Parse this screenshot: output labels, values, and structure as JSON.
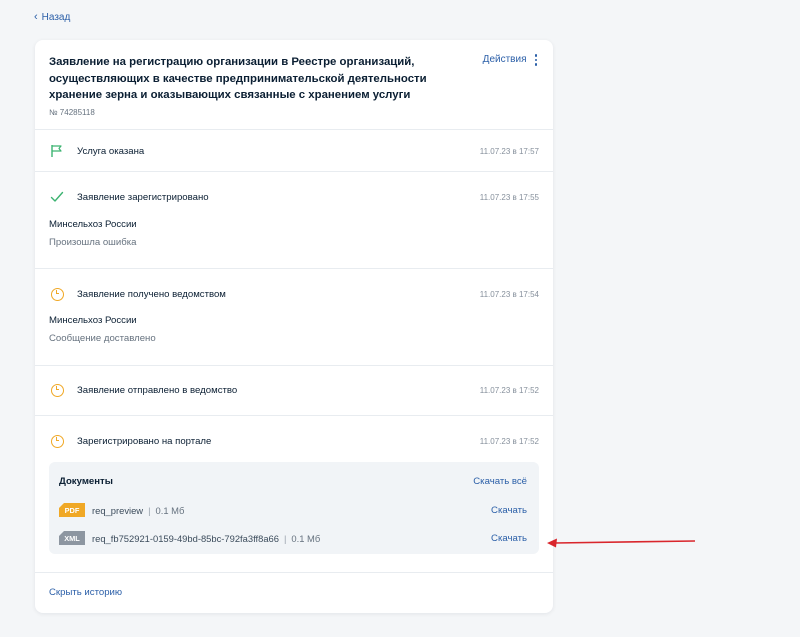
{
  "nav": {
    "back_label": "Назад"
  },
  "application": {
    "title": "Заявление на регистрацию организации в Реестре организаций, осуществляющих в качестве предпринимательской деятельности хранение зерна и оказывающих связанные с хранением услуги",
    "number": "№ 74285118",
    "actions_label": "Действия"
  },
  "events": [
    {
      "label": "Услуга оказана",
      "date": "11.07.23 в 17:57",
      "icon": "flag-icon"
    },
    {
      "label": "Заявление зарегистрировано",
      "date": "11.07.23 в 17:55",
      "icon": "check-icon",
      "org": "Минсельхоз России",
      "status": "Произошла ошибка"
    },
    {
      "label": "Заявление получено ведомством",
      "date": "11.07.23 в 17:54",
      "icon": "clock-icon",
      "org": "Минсельхоз России",
      "status": "Сообщение доставлено"
    },
    {
      "label": "Заявление отправлено в ведомство",
      "date": "11.07.23 в 17:52",
      "icon": "clock-icon"
    },
    {
      "label": "Зарегистрировано на портале",
      "date": "11.07.23 в 17:52",
      "icon": "clock-icon"
    }
  ],
  "documents": {
    "title": "Документы",
    "download_all_label": "Скачать всё",
    "files": [
      {
        "type": "PDF",
        "name": "req_preview",
        "size": "0.1 Мб",
        "download_label": "Скачать"
      },
      {
        "type": "XML",
        "name": "req_fb752921-0159-49bd-85bc-792fa3ff8a66",
        "size": "0.1 Мб",
        "download_label": "Скачать"
      }
    ]
  },
  "footer": {
    "hide_history_label": "Скрыть историю"
  },
  "colors": {
    "link": "#2b5fa8",
    "pending": "#f0a826",
    "success": "#3cb371",
    "annotation_arrow": "#d9262c"
  }
}
